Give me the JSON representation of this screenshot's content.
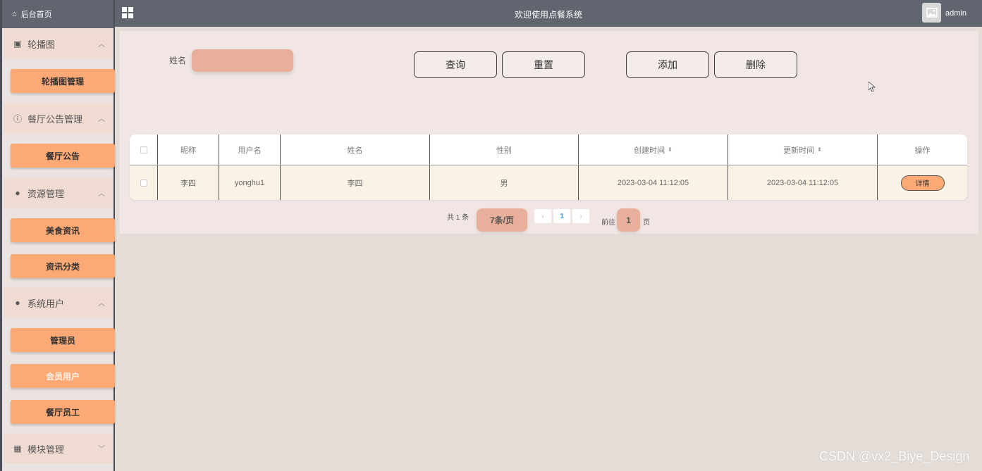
{
  "topbar": {
    "title": "欢迎使用点餐系统",
    "user": "admin"
  },
  "sidebar": {
    "home": "后台首页",
    "groups": [
      {
        "label": "轮播图",
        "icon": "image-icon",
        "expanded": true,
        "items": [
          "轮播图管理"
        ]
      },
      {
        "label": "餐厅公告管理",
        "icon": "info-circle-icon",
        "expanded": true,
        "items": [
          "餐厅公告"
        ]
      },
      {
        "label": "资源管理",
        "icon": "location-pin-icon",
        "expanded": true,
        "items": [
          "美食资讯",
          "资讯分类"
        ]
      },
      {
        "label": "系统用户",
        "icon": "user-icon",
        "expanded": true,
        "items": [
          "管理员",
          "会员用户",
          "餐厅员工"
        ]
      },
      {
        "label": "模块管理",
        "icon": "grid-icon",
        "expanded": false,
        "items": []
      }
    ]
  },
  "search": {
    "name_label": "姓名",
    "name_value": "",
    "query_button": "查询",
    "reset_button": "重置",
    "add_button": "添加",
    "delete_button": "删除"
  },
  "table": {
    "columns": [
      "昵称",
      "用户名",
      "姓名",
      "性别",
      "创建时间",
      "更新时间",
      "操作"
    ],
    "rows": [
      {
        "nickname": "李四",
        "username": "yonghu1",
        "name": "李四",
        "gender": "男",
        "created": "2023-03-04 11:12:05",
        "updated": "2023-03-04 11:12:05",
        "action": "详情"
      }
    ]
  },
  "pagination": {
    "total": "共 1 条",
    "page_size": "7条/页",
    "current_page": "1",
    "goto_label": "前往",
    "goto_value": "1",
    "page_suffix": "页"
  },
  "watermark": "CSDN @vx2_Biye_Design",
  "colors": {
    "accent": "#fda975",
    "topbar": "#606570",
    "input": "#e8b09a"
  }
}
